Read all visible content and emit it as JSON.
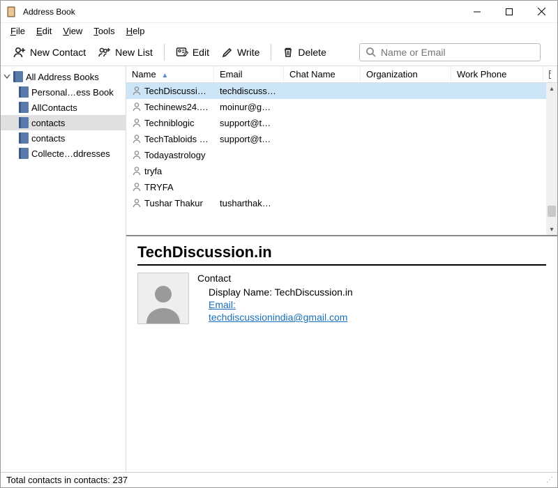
{
  "window": {
    "title": "Address Book"
  },
  "menu": {
    "file": "File",
    "edit": "Edit",
    "view": "View",
    "tools": "Tools",
    "help": "Help"
  },
  "toolbar": {
    "new_contact": "New Contact",
    "new_list": "New List",
    "edit": "Edit",
    "write": "Write",
    "delete": "Delete"
  },
  "search": {
    "placeholder": "Name or Email"
  },
  "tree": {
    "root": "All Address Books",
    "items": [
      {
        "label": "Personal…ess Book"
      },
      {
        "label": "AllContacts"
      },
      {
        "label": "contacts",
        "selected": true
      },
      {
        "label": "contacts"
      },
      {
        "label": "Collecte…ddresses"
      }
    ]
  },
  "columns": {
    "name": "Name",
    "email": "Email",
    "chat": "Chat Name",
    "org": "Organization",
    "work_phone": "Work Phone"
  },
  "contacts": [
    {
      "name": "TechDiscussio…",
      "email": "techdiscuss…",
      "selected": true
    },
    {
      "name": "Techinews24.…",
      "email": "moinur@g…"
    },
    {
      "name": "Techniblogic",
      "email": "support@t…"
    },
    {
      "name": "TechTabloids …",
      "email": "support@t…"
    },
    {
      "name": "Todayastrology",
      "email": ""
    },
    {
      "name": "tryfa",
      "email": ""
    },
    {
      "name": "TRYFA",
      "email": ""
    },
    {
      "name": "Tushar Thakur",
      "email": "tusharthak…"
    }
  ],
  "detail": {
    "title": "TechDiscussion.in",
    "section": "Contact",
    "display_name_label": "Display Name:",
    "display_name": "TechDiscussion.in",
    "email_label": "Email:",
    "email": "techdiscussionindia@gmail.com"
  },
  "status": {
    "text": "Total contacts in contacts: 237"
  }
}
